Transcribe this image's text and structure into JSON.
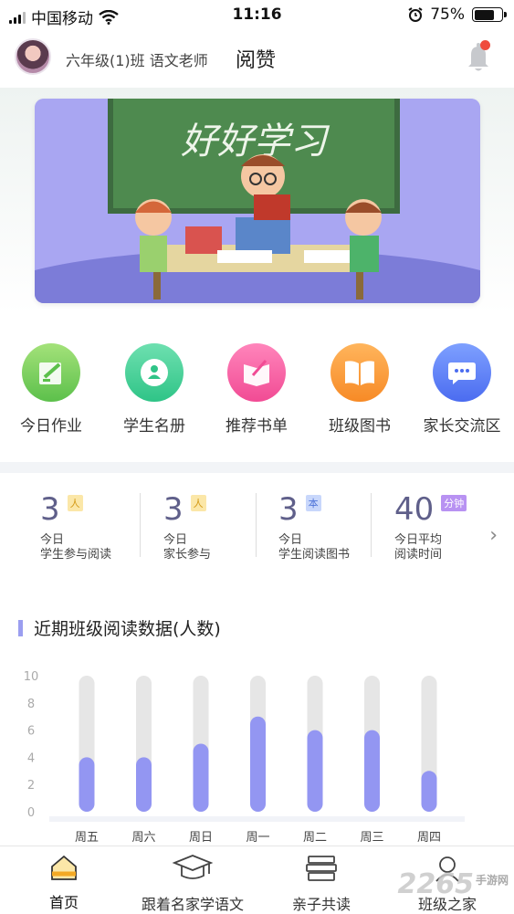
{
  "status_bar": {
    "carrier": "中国移动",
    "time": "11:16",
    "battery": "75%",
    "battery_level": 0.75
  },
  "header": {
    "class_label": "六年级(1)班 语文老师",
    "title": "阅赞"
  },
  "banner": {
    "chalk_text": "好好学习"
  },
  "features": [
    {
      "label": "今日作业",
      "icon": "homework-icon",
      "color": "#7dcf5e"
    },
    {
      "label": "学生名册",
      "icon": "roster-icon",
      "color": "#3fcf9b"
    },
    {
      "label": "推荐书单",
      "icon": "booklist-icon",
      "color": "#f65ea5"
    },
    {
      "label": "班级图书",
      "icon": "book-icon",
      "color": "#f9963a"
    },
    {
      "label": "家长交流区",
      "icon": "chat-icon",
      "color": "#5b7cf5"
    }
  ],
  "stats": [
    {
      "value": "3",
      "unit": "人",
      "line1": "今日",
      "line2": "学生参与阅读",
      "unit_bg": "#fbe7a8",
      "unit_color": "#d49a18"
    },
    {
      "value": "3",
      "unit": "人",
      "line1": "今日",
      "line2": "家长参与",
      "unit_bg": "#fbe7a8",
      "unit_color": "#d49a18"
    },
    {
      "value": "3",
      "unit": "本",
      "line1": "今日",
      "line2": "学生阅读图书",
      "unit_bg": "#c8d7fb",
      "unit_color": "#4f74d8"
    },
    {
      "value": "40",
      "unit": "分钟",
      "line1": "今日平均",
      "line2": "阅读时间",
      "unit_bg": "#b892f2",
      "unit_color": "#ffffff"
    }
  ],
  "chart_title": "近期班级阅读数据(人数)",
  "chart_data": {
    "type": "bar",
    "title": "近期班级阅读数据(人数)",
    "categories": [
      "周五",
      "周六",
      "周日",
      "周一",
      "周二",
      "周三",
      "周四"
    ],
    "values": [
      4,
      4,
      5,
      7,
      6,
      6,
      3
    ],
    "ylim": [
      0,
      10
    ],
    "yticks": [
      "0",
      "2",
      "4",
      "6",
      "8",
      "10"
    ],
    "bar_color": "#9396f2",
    "track_color": "#e6e6e6"
  },
  "tabs": [
    {
      "label": "首页",
      "icon": "home-icon",
      "active": true
    },
    {
      "label": "跟着名家学语文",
      "icon": "mortarboard-icon"
    },
    {
      "label": "亲子共读",
      "icon": "books-icon"
    },
    {
      "label": "班级之家",
      "icon": "class-home-icon"
    }
  ],
  "watermark": {
    "text": "2265",
    "sub": "手游网"
  }
}
